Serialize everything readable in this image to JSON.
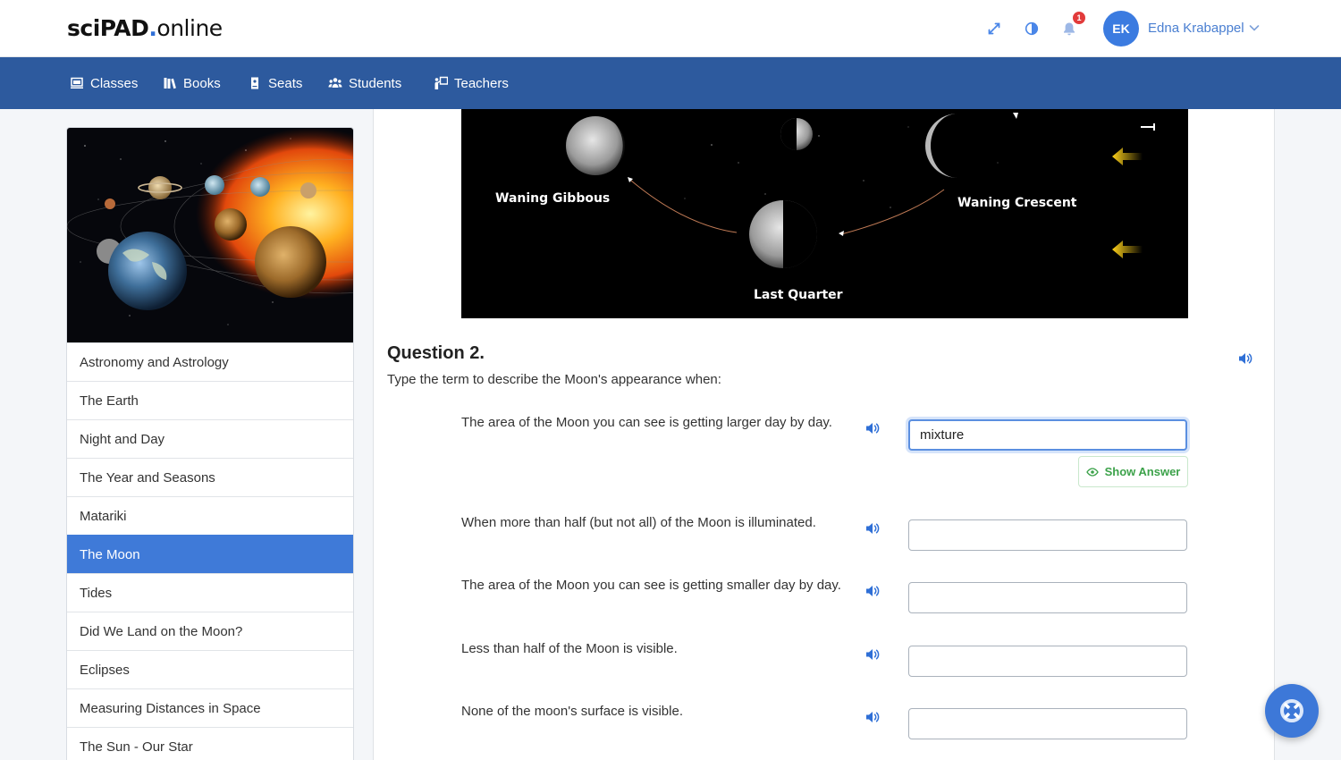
{
  "header": {
    "logo_bold": "sciPAD",
    "logo_dot": ".",
    "logo_rest": "online",
    "notification_count": "1",
    "avatar_initials": "EK",
    "user_name": "Edna Krabappel"
  },
  "nav": {
    "items": [
      {
        "label": "Classes",
        "icon": "classes-icon"
      },
      {
        "label": "Books",
        "icon": "books-icon"
      },
      {
        "label": "Seats",
        "icon": "seats-icon"
      },
      {
        "label": "Students",
        "icon": "students-icon"
      },
      {
        "label": "Teachers",
        "icon": "teachers-icon"
      }
    ]
  },
  "sidebar": {
    "items": [
      {
        "label": "Astronomy and Astrology"
      },
      {
        "label": "The Earth"
      },
      {
        "label": "Night and Day"
      },
      {
        "label": "The Year and Seasons"
      },
      {
        "label": "Matariki"
      },
      {
        "label": "The Moon",
        "active": true
      },
      {
        "label": "Tides"
      },
      {
        "label": "Did We Land on the Moon?"
      },
      {
        "label": "Eclipses"
      },
      {
        "label": "Measuring Distances in Space"
      },
      {
        "label": "The Sun - Our Star"
      }
    ]
  },
  "moon_figure": {
    "labels": {
      "waning_gibbous": "Waning Gibbous",
      "waning_crescent": "Waning Crescent",
      "last_quarter": "Last Quarter"
    }
  },
  "question": {
    "title": "Question 2.",
    "instruction": "Type the term to describe the Moon's appearance when:",
    "show_answer_label": "Show Answer",
    "rows": [
      {
        "prompt": "The area of the Moon you can see is getting larger day by day.",
        "value": "mixture"
      },
      {
        "prompt": "When more than half (but not all) of the Moon is illuminated.",
        "value": ""
      },
      {
        "prompt": "The area of the Moon you can see is getting smaller day by day.",
        "value": ""
      },
      {
        "prompt": "Less than half of the Moon is visible.",
        "value": ""
      },
      {
        "prompt": "None of the moon's surface is visible.",
        "value": ""
      }
    ]
  },
  "colors": {
    "brand_blue": "#2d5a9e",
    "accent_blue": "#3f7ad8",
    "success_green": "#3ca24a",
    "badge_red": "#e23b3b"
  }
}
